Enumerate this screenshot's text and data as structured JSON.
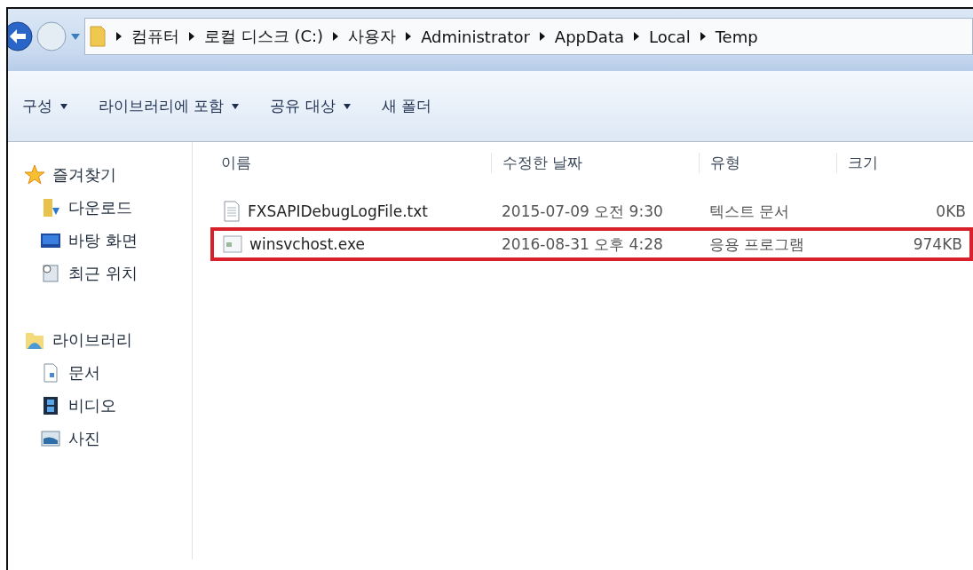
{
  "address_bar": {
    "path": [
      "컴퓨터",
      "로컬 디스크 (C:)",
      "사용자",
      "Administrator",
      "AppData",
      "Local",
      "Temp"
    ]
  },
  "toolbar": {
    "items": [
      {
        "label": "구성",
        "dropdown": true
      },
      {
        "label": "라이브러리에 포함",
        "dropdown": true
      },
      {
        "label": "공유 대상",
        "dropdown": true
      },
      {
        "label": "새 폴더",
        "dropdown": false
      }
    ]
  },
  "sidebar": {
    "groups": [
      {
        "label": "즐겨찾기",
        "children": [
          {
            "label": "다운로드"
          },
          {
            "label": "바탕 화면"
          },
          {
            "label": "최근 위치"
          }
        ]
      },
      {
        "label": "라이브러리",
        "children": [
          {
            "label": "문서"
          },
          {
            "label": "비디오"
          },
          {
            "label": "사진"
          }
        ]
      }
    ]
  },
  "table": {
    "columns": [
      "이름",
      "수정한 날짜",
      "유형",
      "크기"
    ],
    "rows": [
      {
        "name": "FXSAPIDebugLogFile.txt",
        "kind": "text",
        "modified": "2015-07-09 오전 9:30",
        "type": "텍스트 문서",
        "size": "0KB",
        "highlighted": false
      },
      {
        "name": "winsvchost.exe",
        "kind": "program",
        "modified": "2016-08-31 오후 4:28",
        "type": "응용 프로그램",
        "size": "974KB",
        "highlighted": true
      }
    ]
  }
}
